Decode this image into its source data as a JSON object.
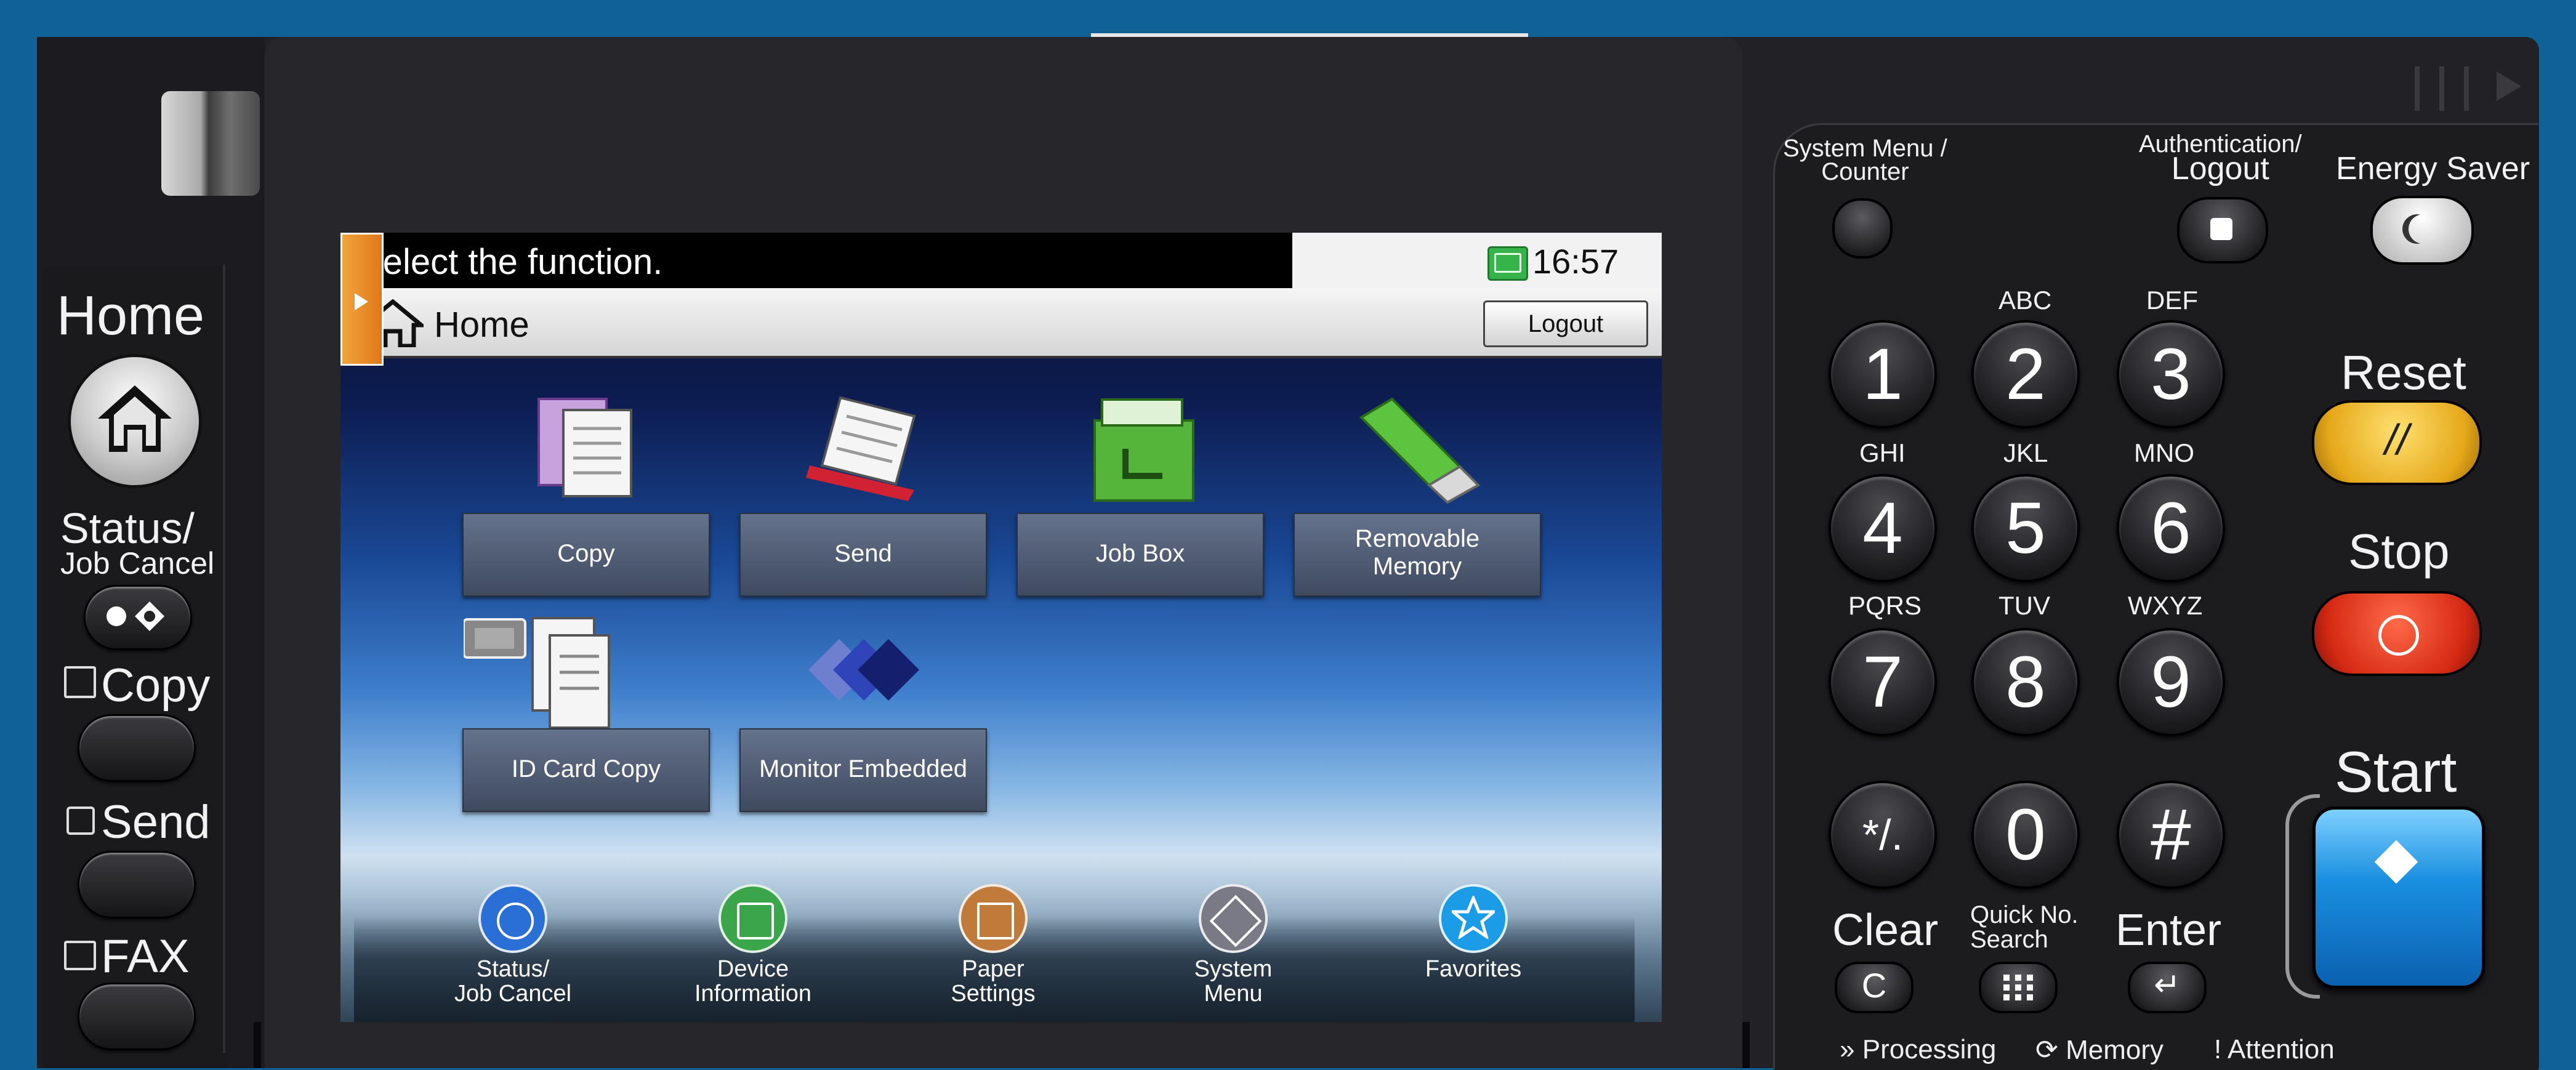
{
  "lcd": {
    "title": "Select the function.",
    "time": "16:57",
    "bar_label": "Home",
    "logout": "Logout",
    "tiles": [
      {
        "key": "copy",
        "line1": "Copy",
        "line2": ""
      },
      {
        "key": "send",
        "line1": "Send",
        "line2": ""
      },
      {
        "key": "jobbox",
        "line1": "Job Box",
        "line2": ""
      },
      {
        "key": "removable",
        "line1": "Removable",
        "line2": "Memory"
      },
      {
        "key": "idcard",
        "line1": "ID Card Copy",
        "line2": ""
      },
      {
        "key": "monitor",
        "line1": "Monitor Embedded",
        "line2": ""
      }
    ],
    "dock": [
      {
        "line1": "Status/",
        "line2": "Job Cancel",
        "color": "#2a6fd6"
      },
      {
        "line1": "Device",
        "line2": "Information",
        "color": "#3aa54a"
      },
      {
        "line1": "Paper",
        "line2": "Settings",
        "color": "#c07a3a"
      },
      {
        "line1": "System",
        "line2": "Menu",
        "color": "#7a7a86"
      },
      {
        "line1": "Favorites",
        "line2": "",
        "color": "#1c9be6"
      }
    ]
  },
  "left_panel": {
    "home": "Home",
    "status_line1": "Status/",
    "status_line2": "Job Cancel",
    "copy": "Copy",
    "send": "Send",
    "fax": "FAX"
  },
  "keypad": {
    "system_menu_line1": "System Menu /",
    "system_menu_line2": "Counter",
    "auth_line1": "Authentication/",
    "auth_line2": "Logout",
    "energy_saver": "Energy Saver",
    "letters": [
      "ABC",
      "DEF",
      "GHI",
      "JKL",
      "MNO",
      "PQRS",
      "TUV",
      "WXYZ"
    ],
    "digits": [
      "1",
      "2",
      "3",
      "4",
      "5",
      "6",
      "7",
      "8",
      "9",
      "*/.",
      "0",
      "#"
    ],
    "reset": "Reset",
    "stop": "Stop",
    "start": "Start",
    "clear": "Clear",
    "quick_line1": "Quick No.",
    "quick_line2": "Search",
    "enter": "Enter",
    "processing": "Processing",
    "memory": "Memory",
    "attention": "Attention"
  }
}
